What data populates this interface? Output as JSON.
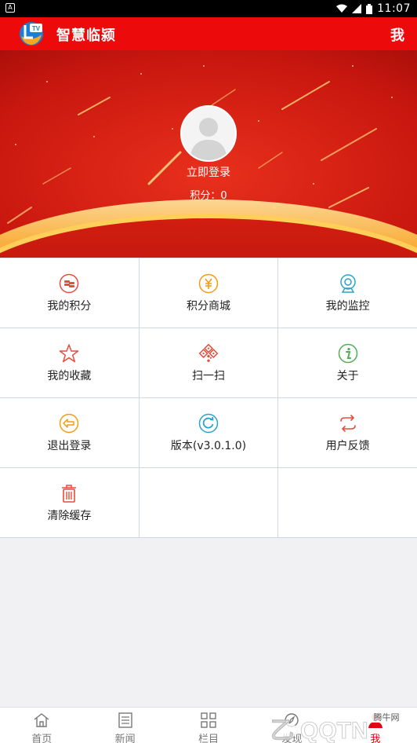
{
  "status_bar": {
    "time": "11:07",
    "left_badge": "A"
  },
  "app_bar": {
    "title": "智慧临颍",
    "right_label": "我"
  },
  "profile": {
    "login_label": "立即登录",
    "points_label": "积分：0"
  },
  "grid": [
    [
      {
        "label": "我的积分",
        "icon": "coins-icon",
        "color": "#e74c3c"
      },
      {
        "label": "积分商城",
        "icon": "yen-coin-icon",
        "color": "#f39c12"
      },
      {
        "label": "我的监控",
        "icon": "webcam-icon",
        "color": "#29a3c9"
      }
    ],
    [
      {
        "label": "我的收藏",
        "icon": "star-icon",
        "color": "#e74c3c"
      },
      {
        "label": "扫一扫",
        "icon": "qr-code-icon",
        "color": "#e74c3c"
      },
      {
        "label": "关于",
        "icon": "info-icon",
        "color": "#4caf50"
      }
    ],
    [
      {
        "label": "退出登录",
        "icon": "logout-arrow-icon",
        "color": "#f39c12"
      },
      {
        "label": "版本(v3.0.1.0)",
        "icon": "refresh-icon",
        "color": "#29a3c9"
      },
      {
        "label": "用户反馈",
        "icon": "exchange-icon",
        "color": "#e74c3c"
      }
    ],
    [
      {
        "label": "清除缓存",
        "icon": "trash-icon",
        "color": "#e74c3c"
      }
    ]
  ],
  "tabs": [
    {
      "label": "首页",
      "icon": "home-icon",
      "active": false
    },
    {
      "label": "新闻",
      "icon": "news-icon",
      "active": false
    },
    {
      "label": "栏目",
      "icon": "grid-icon",
      "active": false
    },
    {
      "label": "发现",
      "icon": "discover-icon",
      "active": false
    },
    {
      "label": "我",
      "icon": "person-icon",
      "active": true
    }
  ],
  "watermark": {
    "text": "QQTN",
    "sub": "腾牛网"
  },
  "colors": {
    "primary": "#ec0a0b",
    "grid_border": "#cfd7e0",
    "active_tab": "#e60012"
  }
}
